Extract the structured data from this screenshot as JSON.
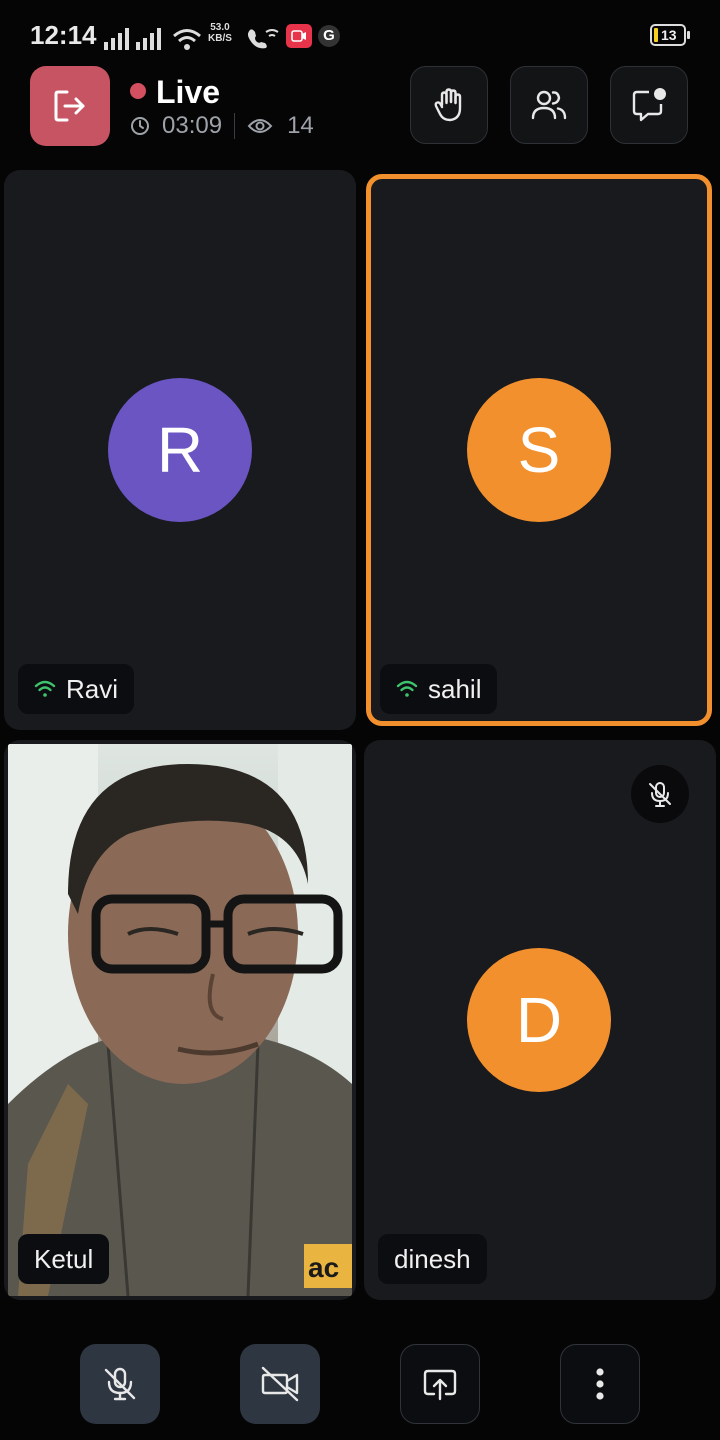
{
  "status_bar": {
    "time": "12:14",
    "net_speed_value": "53.0",
    "net_speed_unit": "KB/S",
    "battery": "13",
    "google_badge": "G"
  },
  "header": {
    "live_label": "Live",
    "duration": "03:09",
    "viewer_count": "14",
    "live_dot_color": "#d44f5f",
    "leave_button_color": "#c75463"
  },
  "participants": [
    {
      "name": "Ravi",
      "initial": "R",
      "avatar_color": "#6a55c2",
      "video_on": false,
      "mic_muted": false,
      "network_icon": "wifi-signal-icon"
    },
    {
      "name": "sahil",
      "initial": "S",
      "avatar_color": "#f3902e",
      "video_on": false,
      "mic_muted": false,
      "active_speaker": true,
      "network_icon": "wifi-signal-icon"
    },
    {
      "name": "Ketul",
      "initial": "",
      "video_on": true,
      "mic_muted": false
    },
    {
      "name": "dinesh",
      "initial": "D",
      "avatar_color": "#f3902e",
      "video_on": false,
      "mic_muted": true
    }
  ],
  "video_overlay_text": "ac",
  "controls": [
    "mic-off-icon",
    "camera-off-icon",
    "screen-share-icon",
    "more-vertical-icon"
  ],
  "accent_color": "#f3902e"
}
